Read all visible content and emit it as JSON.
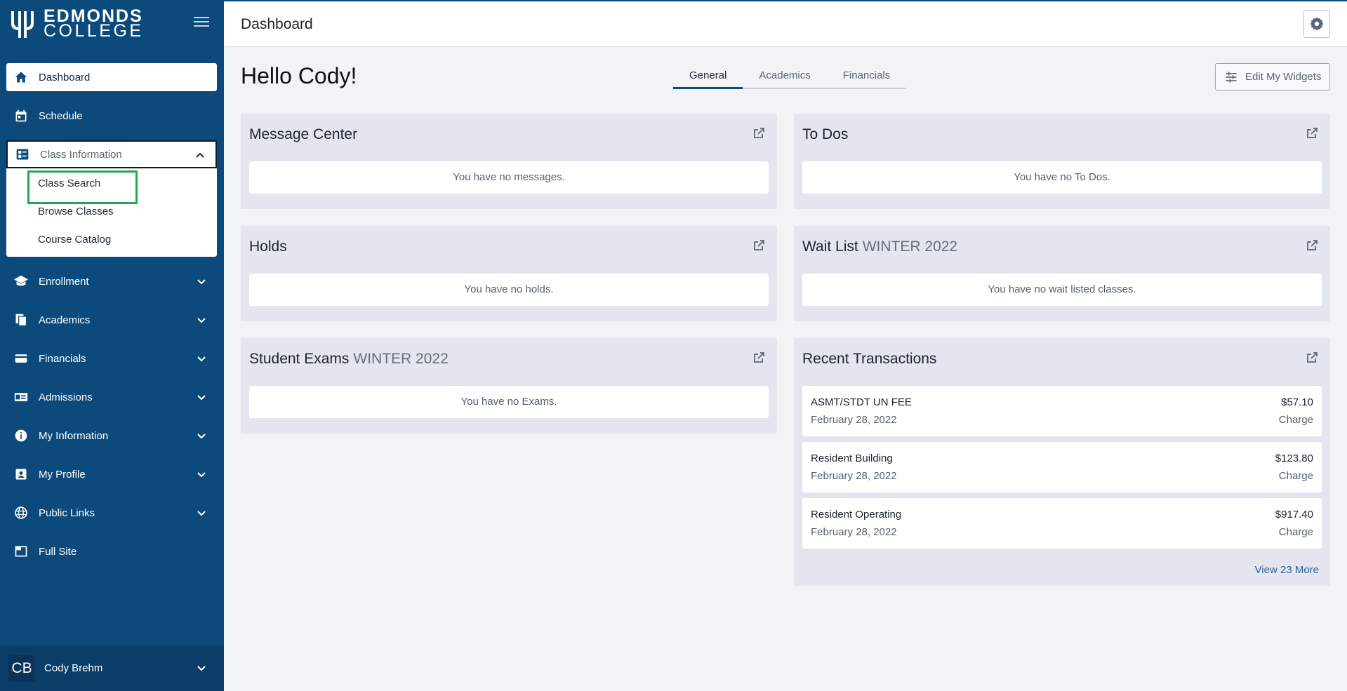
{
  "brand": {
    "line1": "EDMONDS",
    "line2": "COLLEGE"
  },
  "colors": {
    "sidebar": "#0d4a7c",
    "highlight": "#22a84a",
    "widget_bg": "#e4e6ef"
  },
  "sidebar": {
    "items": [
      {
        "label": "Dashboard",
        "icon": "home-icon"
      },
      {
        "label": "Schedule",
        "icon": "calendar-icon"
      },
      {
        "label": "Class Information",
        "icon": "class-info-icon"
      },
      {
        "label": "Enrollment",
        "icon": "graduation-cap-icon"
      },
      {
        "label": "Academics",
        "icon": "documents-icon"
      },
      {
        "label": "Financials",
        "icon": "credit-card-icon"
      },
      {
        "label": "Admissions",
        "icon": "id-card-icon"
      },
      {
        "label": "My Information",
        "icon": "info-icon"
      },
      {
        "label": "My Profile",
        "icon": "profile-icon"
      },
      {
        "label": "Public Links",
        "icon": "globe-icon"
      },
      {
        "label": "Full Site",
        "icon": "window-icon"
      }
    ],
    "submenu": [
      "Class Search",
      "Browse Classes",
      "Course Catalog"
    ]
  },
  "user": {
    "initials": "CB",
    "name": "Cody Brehm"
  },
  "header": {
    "title": "Dashboard"
  },
  "greeting": "Hello Cody!",
  "tabs": [
    "General",
    "Academics",
    "Financials"
  ],
  "edit_widgets_label": "Edit My Widgets",
  "widgets": {
    "messages": {
      "title": "Message Center",
      "empty": "You have no messages."
    },
    "todos": {
      "title": "To Dos",
      "empty": "You have no To Dos."
    },
    "holds": {
      "title": "Holds",
      "empty": "You have no holds."
    },
    "waitlist": {
      "title": "Wait List",
      "term": "WINTER 2022",
      "empty": "You have no wait listed classes."
    },
    "exams": {
      "title": "Student Exams",
      "term": "WINTER 2022",
      "empty": "You have no Exams."
    },
    "transactions": {
      "title": "Recent Transactions",
      "rows": [
        {
          "name": "ASMT/STDT UN FEE",
          "date": "February 28, 2022",
          "amount": "$57.10",
          "type": "Charge"
        },
        {
          "name": "Resident Building",
          "date": "February 28, 2022",
          "amount": "$123.80",
          "type": "Charge"
        },
        {
          "name": "Resident Operating",
          "date": "February 28, 2022",
          "amount": "$917.40",
          "type": "Charge"
        }
      ],
      "view_more": "View 23 More"
    }
  }
}
